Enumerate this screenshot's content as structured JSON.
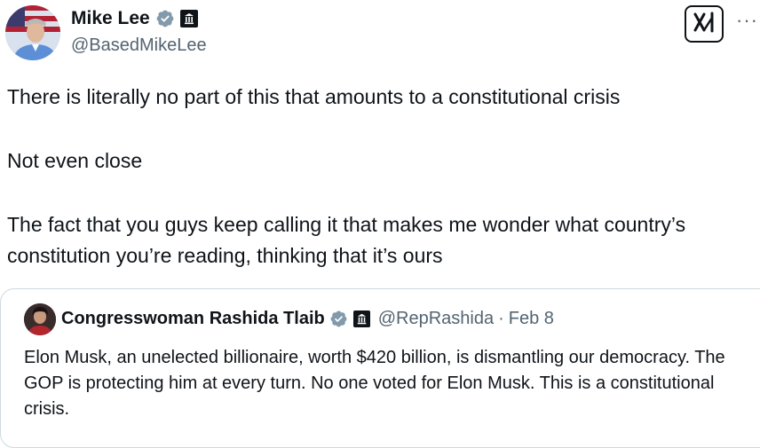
{
  "author": {
    "name": "Mike Lee",
    "handle": "@BasedMikeLee"
  },
  "tweet": {
    "paragraphs": [
      "There is literally no part of this that amounts to a constitutional crisis",
      "Not even close",
      "The fact that you guys keep calling it that makes me wonder what country’s constitution you’re reading, thinking that it’s ours"
    ]
  },
  "actions": {
    "grok_icon": "grok-icon",
    "more_icon": "more-icon",
    "more_label": "···"
  },
  "quoted": {
    "name": "Congresswoman Rashida Tlaib",
    "handle": "@RepRashida",
    "separator": "·",
    "time": "Feb 8",
    "text": "Elon Musk, an unelected billionaire, worth $420 billion, is dismantling our democracy. The GOP is protecting him at every turn. No one voted for Elon Musk. This is a constitutional crisis."
  },
  "colors": {
    "text": "#0f1419",
    "secondary": "#536471",
    "verified_gray": "#829aab",
    "border": "#cfd9de"
  }
}
